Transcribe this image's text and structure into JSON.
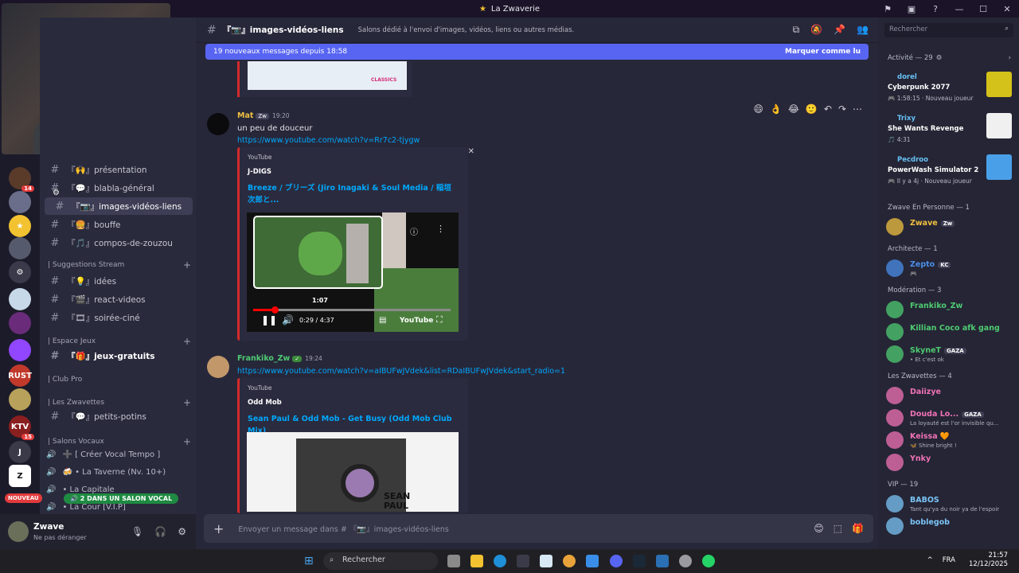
{
  "window": {
    "title": "La Zwaverie",
    "star": "★"
  },
  "titlebar_icons": [
    "⚑",
    "▣",
    "?",
    "—",
    "☐",
    "✕"
  ],
  "servers": [
    {
      "label": "",
      "color": "#5a3b2a",
      "badge": "14"
    },
    {
      "label": "",
      "color": "#6b6e8a",
      "badge": ""
    },
    {
      "label": "★",
      "color": "#f2c230",
      "badge": ""
    },
    {
      "label": "",
      "color": "#555a6c",
      "badge": ""
    },
    {
      "label": "⚙",
      "color": "#3a3a4a",
      "badge": ""
    },
    {
      "label": "",
      "color": "#c7d8e8",
      "badge": ""
    },
    {
      "label": "",
      "color": "#6a2c7a",
      "badge": ""
    },
    {
      "label": "",
      "color": "#9146ff",
      "badge": ""
    },
    {
      "label": "RUST",
      "color": "#c0392b",
      "badge": ""
    },
    {
      "label": "",
      "color": "#b8a15a",
      "badge": ""
    },
    {
      "label": "KTV",
      "color": "#8a1f1f",
      "badge": "15"
    },
    {
      "label": "J",
      "color": "#3a3a48",
      "badge": ""
    },
    {
      "label": "Z",
      "color": "#ffffff",
      "badge": ""
    }
  ],
  "nouveau": "NOUVEAU",
  "channels": [
    {
      "icon": "#",
      "label": "『🙌』présentation"
    },
    {
      "icon": "#",
      "label": "『💬』blabla-général"
    },
    {
      "icon": "#",
      "label": "『📷』images-vidéos-liens",
      "active": true
    },
    {
      "icon": "#",
      "label": "『🍔』bouffe"
    },
    {
      "icon": "#",
      "label": "『🎵』compos-de-zouzou"
    }
  ],
  "cat_suggestions": "| Suggestions Stream",
  "sugg_channels": [
    {
      "icon": "#",
      "label": "『💡』idées"
    },
    {
      "icon": "#",
      "label": "『🎬』react-videos"
    },
    {
      "icon": "#",
      "label": "『🎞』soirée-ciné"
    }
  ],
  "cat_jeux": "| Espace Jeux",
  "jeux_channel": {
    "icon": "#",
    "label": "『🎁』jeux-gratuits"
  },
  "cat_clubpro": "| Club Pro",
  "cat_zwavettes": "| Les Zwavettes",
  "zwavettes_channel": {
    "icon": "#",
    "label": "『💬』petits-potins"
  },
  "cat_vocaux": "| Salons Vocaux",
  "voice_channels": [
    "➕ [ Créer Vocal Tempo ]",
    "🍻 • La Taverne (Nv. 10+)",
    "• La Capitale",
    "• La Cour [V.I.P]"
  ],
  "voice_pill": "🔊 2 DANS UN SALON VOCAL",
  "user": {
    "name": "Zwave",
    "status": "Ne pas déranger"
  },
  "user_controls": [
    "🎙",
    "🎧",
    "⚙"
  ],
  "header": {
    "channel": "『📷』images-vidéos-liens",
    "topic": "Salons dédié à l'envoi d'images, vidéos, liens ou autres médias."
  },
  "header_icons": [
    "⧉",
    "🔕",
    "📌",
    "👥"
  ],
  "new_messages": {
    "text": "19 nouveaux messages depuis 18:58",
    "mark": "Marquer comme lu"
  },
  "msg1": {
    "author": "Mat",
    "tag": "Zw",
    "time": "19:20",
    "text": "un peu de douceur",
    "link": "https://www.youtube.com/watch?v=Rr7c2-tjygw",
    "embed": {
      "provider": "YouTube",
      "author": "J-DIGS",
      "title": "Breeze / ブリーズ (Jiro Inagaki & Soul Media / 稲垣次郎と..."
    },
    "video": {
      "time": "0:29 / 4:37",
      "preview_time": "1:07",
      "progress": 0.11
    }
  },
  "msg2": {
    "author": "Frankiko_Zw",
    "time": "19:24",
    "link": "https://www.youtube.com/watch?v=aIBUFwJVdek&list=RDaIBUFwJVdek&start_radio=1",
    "embed": {
      "provider": "YouTube",
      "author": "Odd Mob",
      "title": "Sean Paul & Odd Mob - Get Busy (Odd Mob Club Mix)"
    },
    "thumb_text": "SEAN PAUL"
  },
  "top_embed_label": "CLASSICS",
  "hover_actions": [
    "😄",
    "👌",
    "😂",
    "🙂",
    "↶",
    "↷",
    "⋯"
  ],
  "input": {
    "placeholder": "Envoyer un message dans # 『📷』images-vidéos-liens"
  },
  "input_icons": [
    "😊",
    "⬚",
    "🎁"
  ],
  "members": {
    "search": "Rechercher",
    "activity_header": "Activité — 29",
    "activities": [
      {
        "name": "dorel",
        "game": "Cyberpunk 2077",
        "time": "🎮 1:58:15 · Nouveau joueur",
        "color": "#d4c21a"
      },
      {
        "name": "Trixy",
        "game": "She Wants Revenge",
        "time": "🎵 4:31",
        "color": "#f0f0f0"
      },
      {
        "name": "Pecdroo",
        "game": "PowerWash Simulator 2",
        "time": "🎮 Il y a 4j · Nouveau joueur",
        "color": "#4aa0e8"
      }
    ],
    "groups": [
      {
        "header": "Zwave En Personne — 1",
        "members": [
          {
            "name": "Zwave",
            "tag": "Zw",
            "status": "",
            "color": "#f0c040"
          }
        ]
      },
      {
        "header": "Architecte — 1",
        "members": [
          {
            "name": "Zepto",
            "tag": "KC",
            "status": "🎮",
            "color": "#4a8ee8"
          }
        ]
      },
      {
        "header": "Modération — 3",
        "members": [
          {
            "name": "Frankiko_Zw",
            "tag": "",
            "status": "",
            "color": "#4ecb71"
          },
          {
            "name": "Killian Coco afk gang",
            "tag": "",
            "status": "",
            "color": "#4ecb71"
          },
          {
            "name": "SkyneT",
            "tag": "GAZA",
            "status": "• Et c'est ok",
            "color": "#4ecb71"
          }
        ]
      },
      {
        "header": "Les Zwavettes — 4",
        "members": [
          {
            "name": "Daiizye",
            "tag": "",
            "status": "",
            "color": "#f072b6"
          },
          {
            "name": "Douda Lo...",
            "tag": "GAZA",
            "status": "La loyauté est l'or invisible qu...",
            "color": "#f072b6"
          },
          {
            "name": "Keissa 🧡",
            "tag": "",
            "status": "🦋 Shine bright !",
            "color": "#f072b6"
          },
          {
            "name": "Ynky",
            "tag": "",
            "status": "",
            "color": "#f072b6"
          }
        ]
      },
      {
        "header": "VIP — 19",
        "members": [
          {
            "name": "BABOS",
            "tag": "",
            "status": "Tant qu'ya du noir ya de l'espoir",
            "color": "#7bc4f5"
          },
          {
            "name": "boblegob",
            "tag": "",
            "status": "",
            "color": "#7bc4f5"
          }
        ]
      }
    ]
  },
  "taskbar": {
    "search": "Rechercher",
    "lang": "FRA",
    "time": "21:57",
    "date": "12/12/2025",
    "tray": "^"
  }
}
